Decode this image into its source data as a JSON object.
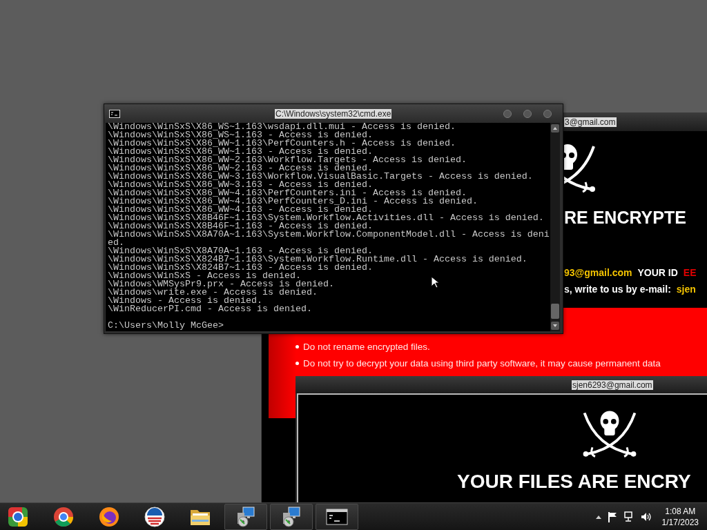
{
  "ransom_window_back": {
    "title": "3@gmail.com",
    "heading": "RE ENCRYPTE",
    "contact_line": {
      "email": "93@gmail.com",
      "id_label": "YOUR ID",
      "id_value": "EE"
    },
    "write_line": {
      "text": "s, write to us by e-mail:",
      "email": "sjen"
    },
    "rules": [
      "Do not rename encrypted files.",
      "Do not try to decrypt your data using third party software, it may cause permanent data"
    ]
  },
  "ransom_window_front": {
    "title": "sjen6293@gmail.com",
    "heading": "YOUR FILES ARE ENCRY"
  },
  "console_window": {
    "title": "C:\\Windows\\system32\\cmd.exe",
    "lines": [
      "\\Windows\\WinSxS\\X86_WS~1.163\\wsdapi.dll.mui - Access is denied.",
      "\\Windows\\WinSxS\\X86_WS~1.163 - Access is denied.",
      "\\Windows\\WinSxS\\X86_WW~1.163\\PerfCounters.h - Access is denied.",
      "\\Windows\\WinSxS\\X86_WW~1.163 - Access is denied.",
      "\\Windows\\WinSxS\\X86_WW~2.163\\Workflow.Targets - Access is denied.",
      "\\Windows\\WinSxS\\X86_WW~2.163 - Access is denied.",
      "\\Windows\\WinSxS\\X86_WW~3.163\\Workflow.VisualBasic.Targets - Access is denied.",
      "\\Windows\\WinSxS\\X86_WW~3.163 - Access is denied.",
      "\\Windows\\WinSxS\\X86_WW~4.163\\PerfCounters.ini - Access is denied.",
      "\\Windows\\WinSxS\\X86_WW~4.163\\PerfCounters_D.ini - Access is denied.",
      "\\Windows\\WinSxS\\X86_WW~4.163 - Access is denied.",
      "\\Windows\\WinSxS\\X8B46F~1.163\\System.Workflow.Activities.dll - Access is denied.",
      "\\Windows\\WinSxS\\X8B46F~1.163 - Access is denied.",
      "\\Windows\\WinSxS\\X8A70A~1.163\\System.Workflow.ComponentModel.dll - Access is deni",
      "ed.",
      "\\Windows\\WinSxS\\X8A70A~1.163 - Access is denied.",
      "\\Windows\\WinSxS\\X824B7~1.163\\System.Workflow.Runtime.dll - Access is denied.",
      "\\Windows\\WinSxS\\X824B7~1.163 - Access is denied.",
      "\\Windows\\WinSxS - Access is denied.",
      "\\Windows\\WMSysPr9.prx - Access is denied.",
      "\\Windows\\write.exe - Access is denied.",
      "\\Windows - Access is denied.",
      "\\WinReducerPI.cmd - Access is denied."
    ],
    "prompt": "C:\\Users\\Molly McGee>"
  },
  "taskbar": {
    "apps": [
      {
        "kind": "square_ring",
        "running": false
      },
      {
        "kind": "ring",
        "running": false
      },
      {
        "kind": "flame",
        "running": false
      },
      {
        "kind": "stripes",
        "running": false
      },
      {
        "kind": "folder",
        "running": false
      },
      {
        "kind": "installer",
        "running": true
      },
      {
        "kind": "installer",
        "running": true
      },
      {
        "kind": "terminal",
        "running": true
      }
    ],
    "clock": {
      "time": "1:08 AM",
      "date": "1/17/2023"
    }
  }
}
